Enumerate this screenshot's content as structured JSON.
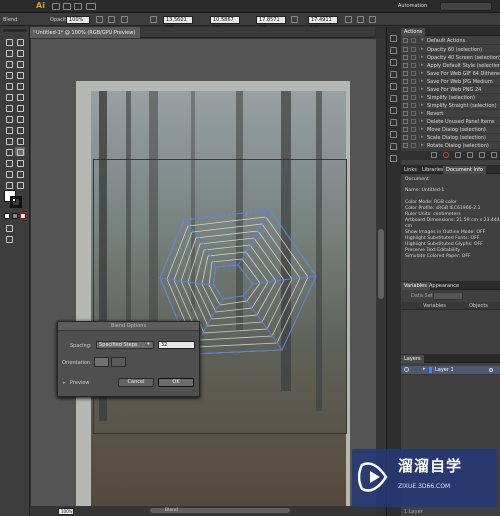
{
  "app": {
    "logo": "Ai",
    "workspace": "Automation"
  },
  "control_bar": {
    "mode": "Blend",
    "opacity_label": "Opacity:",
    "opacity_value": "100%",
    "x_value": "13.5601 cm",
    "y_value": "10.5867 cm",
    "w_value": "17.8571 cm",
    "h_value": "17.4911 cm"
  },
  "document_tab": {
    "title": "Untitled-1* @ 100% (RGB/GPU Preview)",
    "close": "×"
  },
  "status_bar": {
    "zoom": "100%",
    "tool": "Blend"
  },
  "actions_panel": {
    "tab": "Actions",
    "set_name": "Default Actions",
    "items": [
      "Opacity 60 (selection)",
      "Opacity 40 Screen (selection)",
      "Apply Default Style (selection)",
      "Save For Web GIF 64 Dithered",
      "Save For Web JPG Medium",
      "Save For Web PNG 24",
      "Simplify (selection)",
      "Simplify Straight (selection)",
      "Revert",
      "Delete Unused Panel Items",
      "Move Dialog (selection)",
      "Scale Dialog (selection)",
      "Rotate Dialog (selection)"
    ]
  },
  "info_panel": {
    "tabs": [
      "Links",
      "Libraries",
      "Document Info"
    ],
    "active_tab": "Document Info",
    "heading": "Document",
    "lines": [
      "Name: Untitled-1",
      "",
      "Color Mode: RGB color",
      "Color Profile: sRGB IEC61966-2.1",
      "Ruler Units: centimeters",
      "Artboard Dimensions: 21.59 cm x 23.4448",
      "cm",
      "Show Images in Outline Mode: OFF",
      "Highlight Substituted Fonts: OFF",
      "Highlight Substituted Glyphs: OFF",
      "Preserve Text Editability",
      "Simulate Colored Paper: OFF"
    ]
  },
  "variables_panel": {
    "tabs": [
      "Variables",
      "Appearance"
    ],
    "data_set_label": "Data Set:",
    "col_variables": "Variables",
    "col_objects": "Objects"
  },
  "layers_panel": {
    "tab": "Layers",
    "layer_name": "Layer 1",
    "footer": "1 Layer"
  },
  "blend_dialog": {
    "title": "Blend Options",
    "spacing_label": "Spacing:",
    "spacing_value": "Specified Steps",
    "steps_value": "32",
    "orientation_label": "Orientation:",
    "preview_label": "Preview",
    "cancel_label": "Cancel",
    "ok_label": "OK"
  },
  "watermark": {
    "brand": "溜溜自学",
    "url": "ZIXUE.3D66.COM"
  }
}
